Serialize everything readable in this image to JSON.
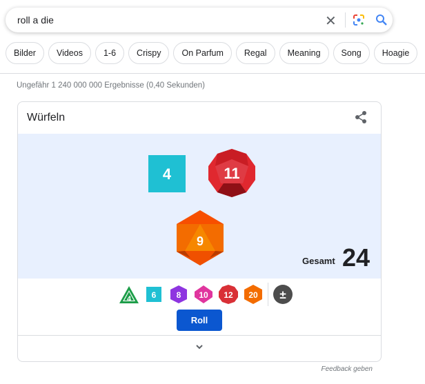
{
  "search": {
    "query": "roll a die",
    "clear_icon": "close-icon",
    "lens_icon": "google-lens-icon",
    "search_icon": "search-icon"
  },
  "chips": [
    "Bilder",
    "Videos",
    "1-6",
    "Crispy",
    "On Parfum",
    "Regal",
    "Meaning",
    "Song",
    "Hoagie"
  ],
  "stats": "Ungefähr 1 240 000 000 Ergebnisse (0,40 Sekunden)",
  "card": {
    "title": "Würfeln",
    "share_icon": "share-icon",
    "dice": [
      {
        "type": "d6",
        "value": "4",
        "color": "#1fc0d3"
      },
      {
        "type": "d12",
        "value": "11",
        "color": "#d93036"
      },
      {
        "type": "d20",
        "value": "9",
        "color": "#f36c00"
      }
    ],
    "total_label": "Gesamt",
    "total_value": "24",
    "picker": [
      {
        "label": "4",
        "type": "d4",
        "color": "#1e9e4a"
      },
      {
        "label": "6",
        "type": "d6",
        "color": "#1fc0d3"
      },
      {
        "label": "8",
        "type": "d8",
        "color": "#8e35e0"
      },
      {
        "label": "10",
        "type": "d10",
        "color": "#e0359e"
      },
      {
        "label": "12",
        "type": "d12",
        "color": "#d93036"
      },
      {
        "label": "20",
        "type": "d20",
        "color": "#f36c00"
      },
      {
        "label": "±",
        "type": "modifier",
        "color": "#4d4d4d"
      }
    ],
    "roll_label": "Roll",
    "expand_icon": "chevron-down-icon"
  },
  "feedback": "Feedback geben"
}
